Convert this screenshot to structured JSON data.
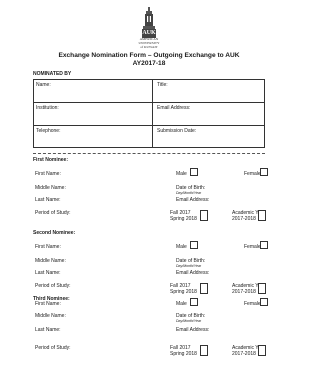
{
  "logo": {
    "abbrev": "AUK",
    "name_line1": "AMERICAN",
    "name_line2": "UNIVERSITY",
    "name_line3": "of KUWAIT"
  },
  "title": {
    "line1": "Exchange Nomination Form – Outgoing Exchange to AUK",
    "line2": "AY2017-18"
  },
  "nominated_by": {
    "heading": "NOMINATED BY",
    "name": "Name:",
    "title": "Title:",
    "institution": "Institution:",
    "email": "Email Address:",
    "telephone": "Telephone:",
    "submission_date": "Submission Date:"
  },
  "nominees": [
    {
      "heading": "First Nominee:",
      "first_name": "First Name:",
      "male": "Male",
      "female": "Female",
      "middle_name": "Middle Name:",
      "dob": "Date of Birth:",
      "dob_format": "Day/Month/Year",
      "last_name": "Last Name:",
      "email": "Email Address:",
      "period": "Period of Study:",
      "fall": "Fall 2017",
      "spring": "Spring 2018",
      "academic_year": "Academic Year",
      "academic_year_value": "2017-2018"
    },
    {
      "heading": "Second Nominee:",
      "first_name": "First Name:",
      "male": "Male",
      "female": "Female",
      "middle_name": "Middle Name:",
      "dob": "Date of Birth:",
      "dob_format": "Day/Month/Year",
      "last_name": "Last Name:",
      "email": "Email Address:",
      "period": "Period of Study:",
      "fall": "Fall 2017",
      "spring": "Spring 2018",
      "academic_year": "Academic Year",
      "academic_year_value": "2017-2018"
    },
    {
      "heading": "Third Nominee:",
      "first_name": "First Name:",
      "male": "Male",
      "female": "Female",
      "middle_name": "Middle Name:",
      "dob": "Date of Birth:",
      "dob_format": "Day/Month/Year",
      "last_name": "Last Name:",
      "email": "Email Address:",
      "period": "Period of Study:",
      "fall": "Fall 2017",
      "spring": "Spring 2018",
      "academic_year": "Academic Year",
      "academic_year_value": "2017-2018"
    }
  ]
}
